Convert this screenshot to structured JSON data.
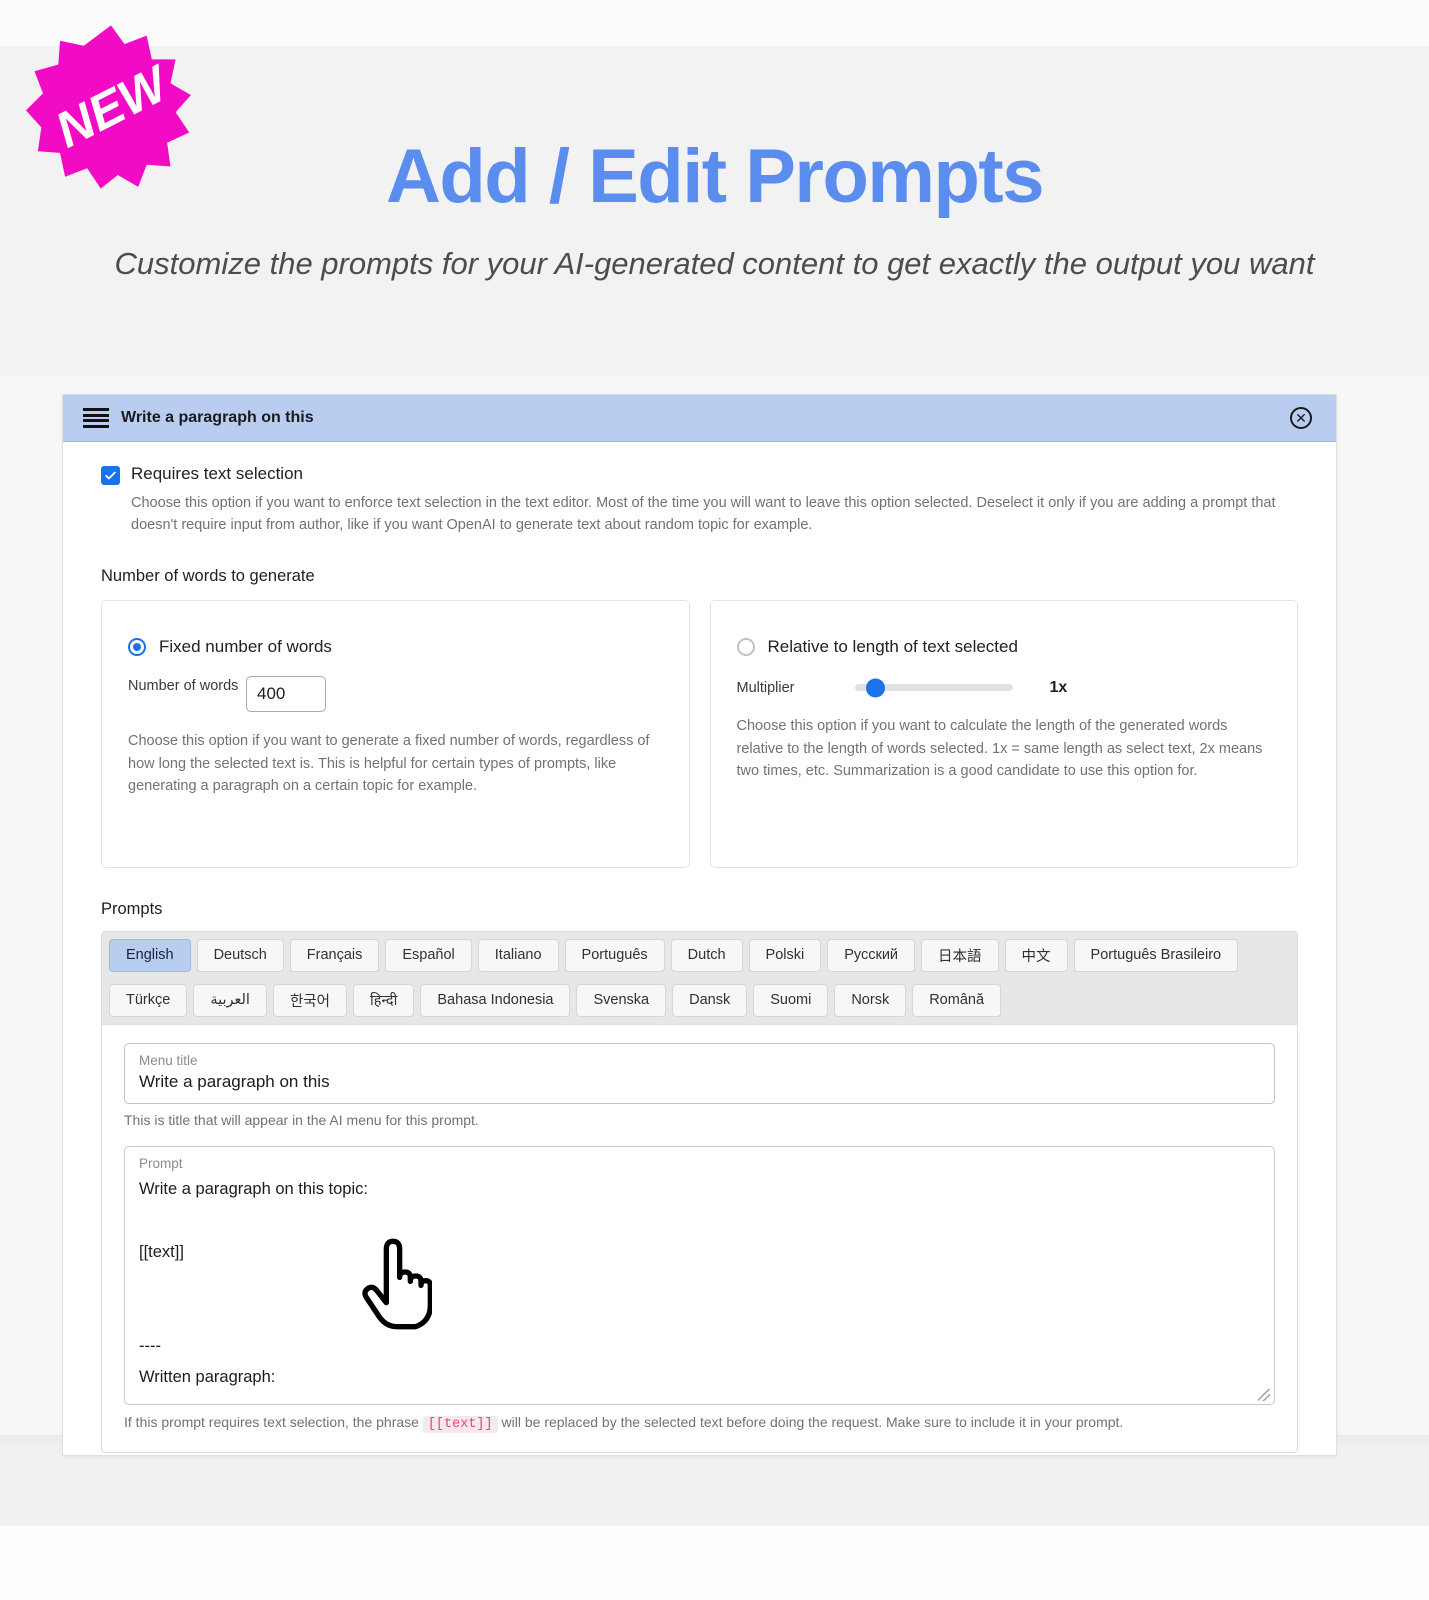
{
  "badge": {
    "label": "NEW"
  },
  "hero": {
    "title": "Add / Edit Prompts",
    "subtitle": "Customize the prompts for your AI-generated content\nto get exactly the output you want",
    "title_color": "#5b8dee"
  },
  "panel": {
    "header_title": "Write a paragraph on this",
    "header_color": "#b9cdf0",
    "drag_handle_icon": "drag-handle-icon",
    "close_icon": "close-circle-icon",
    "close_glyph": "✕"
  },
  "requires_text_selection": {
    "checked": true,
    "label": "Requires text selection",
    "help": "Choose this option if you want to enforce text selection in the text editor. Most of the time you will want to leave this option selected. Deselect it only if you are adding a prompt that doesn't require input from author, like if you want OpenAI to generate text about random topic for example."
  },
  "words_section": {
    "label": "Number of words to generate",
    "fixed": {
      "selected": true,
      "radio_label": "Fixed number of words",
      "field_label": "Number of words",
      "value": "400",
      "help": "Choose this option if you want to generate a fixed number of words, regardless of how long the selected text is. This is helpful for certain types of prompts, like generating a paragraph on a certain topic for example."
    },
    "relative": {
      "selected": false,
      "radio_label": "Relative to length of text selected",
      "slider_label": "Multiplier",
      "slider_value": "1x",
      "slider_percent": 8,
      "help": "Choose this option if you want to calculate the length of the generated words relative to the length of words selected. 1x = same length as select text, 2x means two times, etc. Summarization is a good candidate to use this option for."
    }
  },
  "prompts_section": {
    "label": "Prompts",
    "tabs_row1": [
      "English",
      "Deutsch",
      "Français",
      "Español",
      "Italiano",
      "Português",
      "Dutch",
      "Polski",
      "Русский",
      "日本語",
      "中文",
      "Português Brasileiro"
    ],
    "tabs_row2": [
      "Türkçe",
      "العربية",
      "한국어",
      "हिन्दी",
      "Bahasa Indonesia",
      "Svenska",
      "Dansk",
      "Suomi",
      "Norsk",
      "Română"
    ],
    "active_tab": "English",
    "menu_title": {
      "label": "Menu title",
      "value": "Write a paragraph on this",
      "help": "This is title that will appear in the AI menu for this prompt."
    },
    "prompt": {
      "label": "Prompt",
      "value": "Write a paragraph on this topic:\n\n[[text]]\n\n\n----\nWritten paragraph:",
      "help_before": "If this prompt requires text selection, the phrase",
      "help_code": "[[text]]",
      "help_after": "will be replaced by the selected text before doing the request. Make sure to include it in your prompt."
    }
  },
  "cursor": {
    "icon": "pointing-hand-cursor"
  }
}
